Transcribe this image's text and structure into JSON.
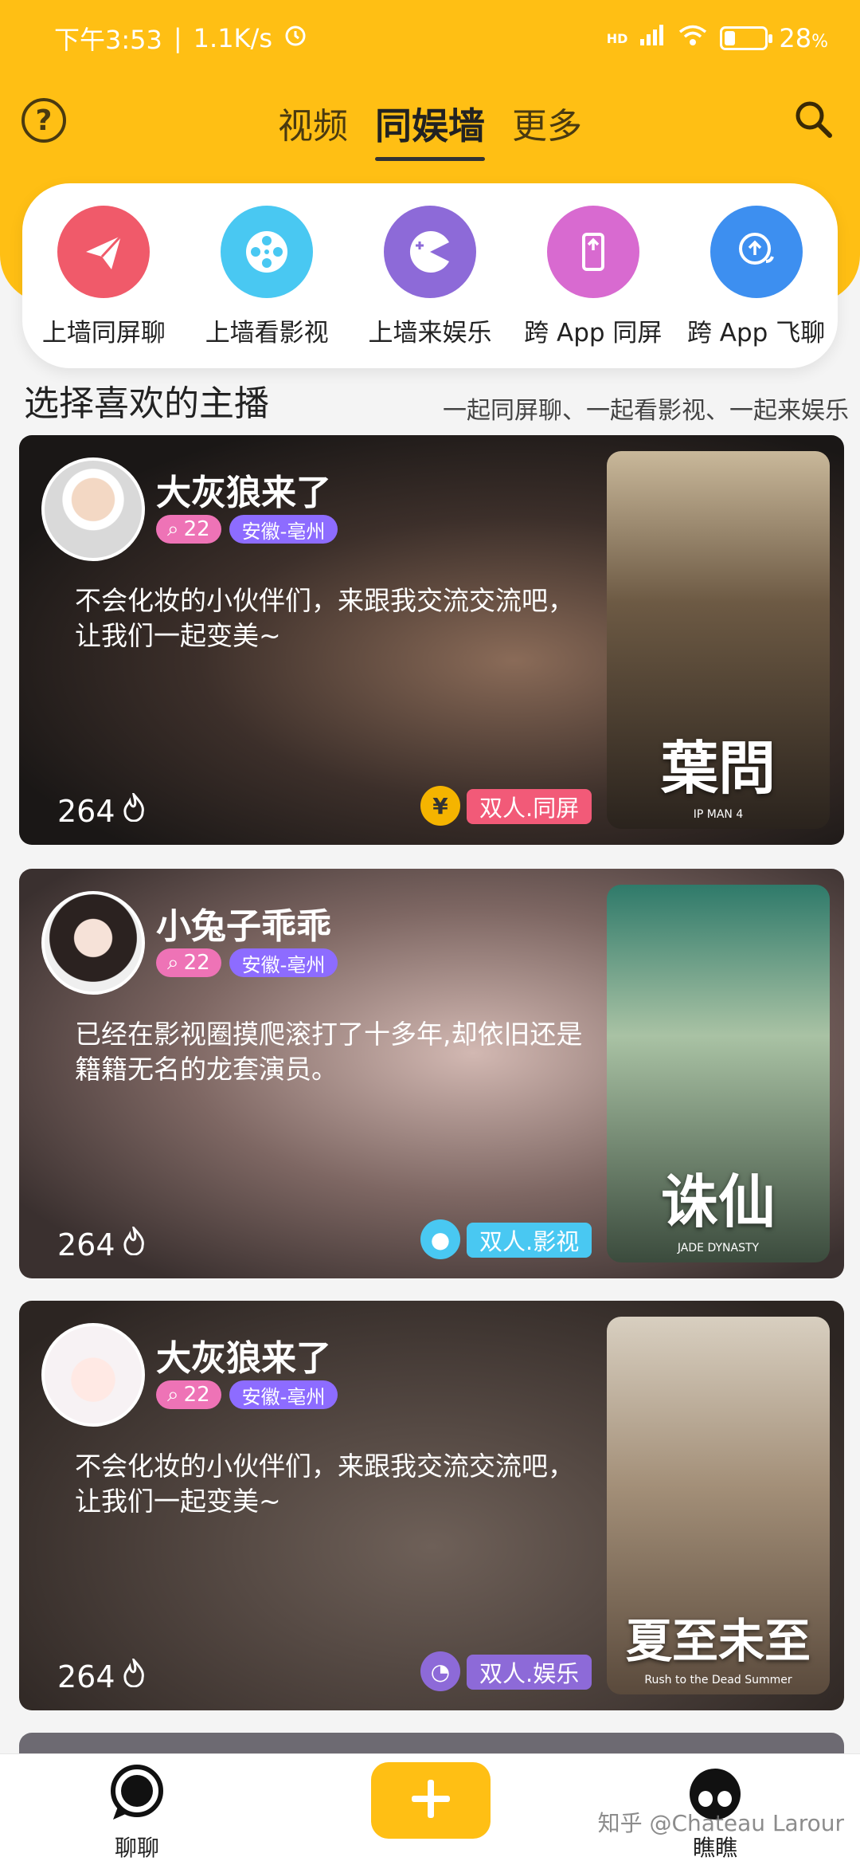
{
  "status_bar": {
    "time": "下午3:53",
    "network_speed": "1.1K/s",
    "alarm_icon": "alarm-clock-icon",
    "signal": "HD",
    "battery_percent": "28",
    "battery_unit": "%",
    "battery_level": 0.28
  },
  "nav": {
    "help_icon": "question-circle-icon",
    "help_glyph": "?",
    "tabs": [
      {
        "label": "视频",
        "active": false
      },
      {
        "label": "同娱墙",
        "active": true
      },
      {
        "label": "更多",
        "active": false
      }
    ],
    "search_icon": "search-icon"
  },
  "quick_actions": [
    {
      "label": "上墙同屏聊",
      "icon": "paper-plane-icon",
      "color": "#f05a6a"
    },
    {
      "label": "上墙看影视",
      "icon": "film-reel-icon",
      "color": "#49c8f2"
    },
    {
      "label": "上墙来娱乐",
      "icon": "game-pacman-icon",
      "color": "#8d6ad8"
    },
    {
      "label": "跨 App 同屏",
      "icon": "phone-share-icon",
      "color": "#d86ad0"
    },
    {
      "label": "跨 App 飞聊",
      "icon": "chat-bubble-upload-icon",
      "color": "#3d8ff0"
    }
  ],
  "section": {
    "title": "选择喜欢的主播",
    "subtitle": "一起同屏聊、一起看影视、一起来娱乐"
  },
  "cards": [
    {
      "name": "大灰狼来了",
      "count": "22",
      "location": "安徽-亳州",
      "description": "不会化妆的小伙伴们，来跟我交流交流吧，让我们一起变美~",
      "heat": "264",
      "type_icon_glyph": "¥",
      "type_icon_color": "#f5b400",
      "type_label": "双人.同屏",
      "type_color": "#f25a78",
      "poster_title": "葉問",
      "poster_caption": "IP MAN 4"
    },
    {
      "name": "小兔子乖乖",
      "count": "22",
      "location": "安徽-亳州",
      "description": "已经在影视圈摸爬滚打了十多年,却依旧还是籍籍无名的龙套演员。",
      "heat": "264",
      "type_icon_glyph": "●",
      "type_icon_color": "#49c8f2",
      "type_label": "双人.影视",
      "type_color": "#49c8f2",
      "poster_title": "诛仙",
      "poster_caption": "JADE DYNASTY"
    },
    {
      "name": "大灰狼来了",
      "count": "22",
      "location": "安徽-亳州",
      "description": "不会化妆的小伙伴们，来跟我交流交流吧，让我们一起变美~",
      "heat": "264",
      "type_icon_glyph": "◔",
      "type_icon_color": "#8d6ad8",
      "type_label": "双人.娱乐",
      "type_color": "#8d6ad8",
      "poster_title": "夏至未至",
      "poster_caption": "Rush to the Dead Summer"
    }
  ],
  "bottom_nav": {
    "chat_label": "聊聊",
    "look_label": "瞧瞧",
    "add_icon": "plus-icon",
    "watermark": "知乎 @Chateau Larour"
  }
}
